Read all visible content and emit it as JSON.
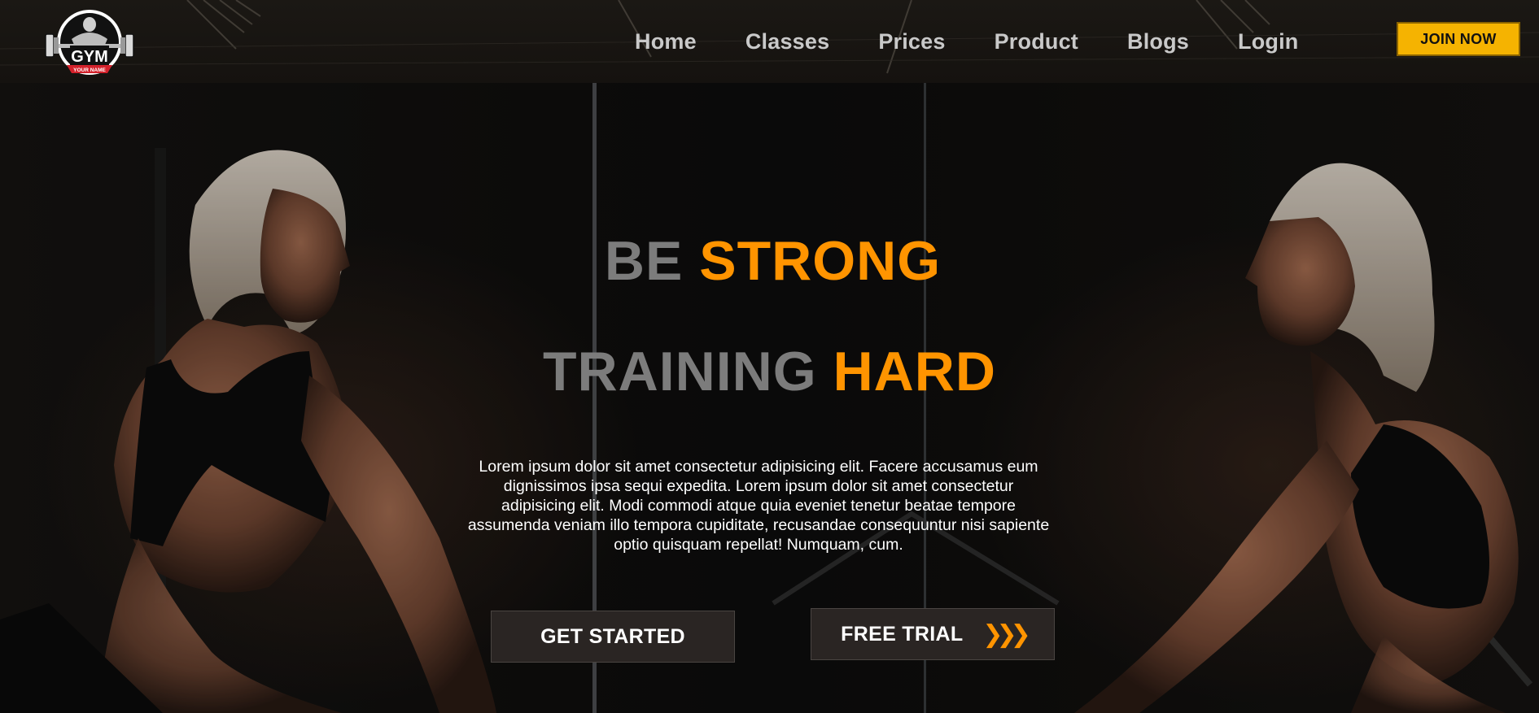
{
  "brand": {
    "logo_text": "GYM",
    "logo_subtext": "YOUR NAME",
    "accent_color": "#ff9400",
    "button_color": "#f5b301"
  },
  "nav": {
    "items": [
      {
        "label": "Home"
      },
      {
        "label": "Classes"
      },
      {
        "label": "Prices"
      },
      {
        "label": "Product"
      },
      {
        "label": "Blogs"
      },
      {
        "label": "Login"
      }
    ],
    "join_label": "JOIN NOW"
  },
  "hero": {
    "line1_grey": "BE",
    "line1_orange": "STRONG",
    "line2_grey": "TRAINING",
    "line2_orange": "HARD",
    "paragraph": "Lorem ipsum dolor sit amet consectetur adipisicing elit. Facere accusamus eum dignissimos ipsa sequi expedita. Lorem ipsum dolor sit amet consectetur adipisicing elit. Modi commodi atque quia eveniet tenetur beatae tempore assumenda veniam illo tempora cupiditate, recusandae consequuntur nisi sapiente optio quisquam repellat! Numquam, cum.",
    "get_started_label": "GET STARTED",
    "free_trial_label": "FREE TRIAL",
    "free_trial_icon": "double-chevron-right-icon"
  }
}
